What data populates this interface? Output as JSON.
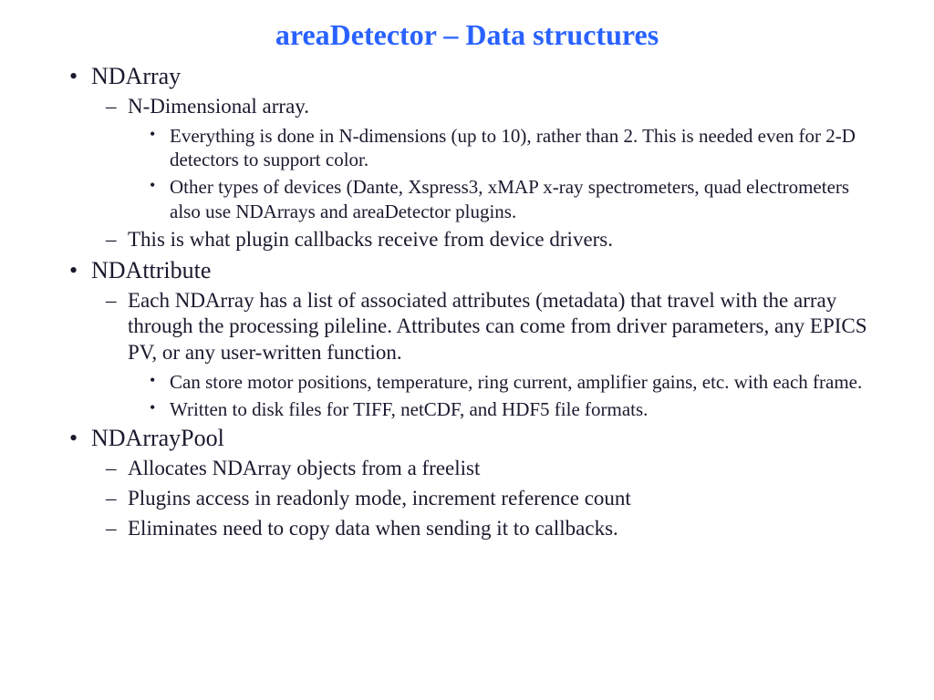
{
  "title": "areaDetector – Data structures",
  "sections": [
    {
      "heading": "NDArray",
      "sub": [
        {
          "text": "N-Dimensional array.",
          "sub": [
            "Everything is done in N-dimensions (up to 10), rather than 2.  This is needed even for 2-D detectors to support color.",
            "Other types of devices (Dante, Xspress3, xMAP x-ray spectrometers, quad electrometers also use NDArrays and areaDetector plugins."
          ]
        },
        {
          "text": "This is what plugin callbacks receive from device drivers.",
          "sub": []
        }
      ]
    },
    {
      "heading": "NDAttribute",
      "sub": [
        {
          "text": "Each NDArray has a list of associated attributes (metadata) that travel with the array through the processing pileline.  Attributes can come from driver parameters, any EPICS PV, or any user-written function.",
          "sub": [
            "Can store motor positions, temperature, ring current, amplifier gains, etc. with each frame.",
            "Written to disk files for TIFF, netCDF, and HDF5 file formats."
          ]
        }
      ]
    },
    {
      "heading": "NDArrayPool",
      "sub": [
        {
          "text": "Allocates NDArray objects from a freelist",
          "sub": []
        },
        {
          "text": "Plugins access in readonly mode, increment reference count",
          "sub": []
        },
        {
          "text": "Eliminates need to copy data when sending it to callbacks.",
          "sub": []
        }
      ]
    }
  ]
}
